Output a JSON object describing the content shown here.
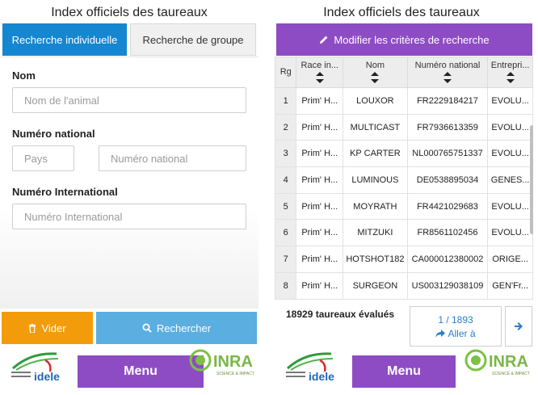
{
  "left": {
    "title": "Index officiels des taureaux",
    "tabs": {
      "individual": "Recherche individuelle",
      "group": "Recherche de groupe"
    },
    "form": {
      "name_label": "Nom",
      "name_placeholder": "Nom de l'animal",
      "national_label": "Numéro national",
      "country_placeholder": "Pays",
      "national_placeholder": "Numéro national",
      "international_label": "Numéro International",
      "international_placeholder": "Numéro International"
    },
    "buttons": {
      "clear": "Vider",
      "search": "Rechercher"
    },
    "menu": "Menu"
  },
  "right": {
    "title": "Index officiels des taureaux",
    "modify_button": "Modifier les critères de recherche",
    "table": {
      "headers": [
        "Rg",
        "Race in...",
        "Nom",
        "Numéro national",
        "Entrepri..."
      ],
      "rows": [
        [
          "1",
          "Prim' H...",
          "LOUXOR",
          "FR2229184217",
          "EVOLU..."
        ],
        [
          "2",
          "Prim' H...",
          "MULTICAST",
          "FR7936613359",
          "EVOLU..."
        ],
        [
          "3",
          "Prim' H...",
          "KP CARTER",
          "NL000765751337",
          "EVOLU..."
        ],
        [
          "4",
          "Prim' H...",
          "LUMINOUS",
          "DE0538895034",
          "GENES..."
        ],
        [
          "5",
          "Prim' H...",
          "MOYRATH",
          "FR4421029683",
          "EVOLU..."
        ],
        [
          "6",
          "Prim' H...",
          "MITZUKI",
          "FR8561102456",
          "EVOLU..."
        ],
        [
          "7",
          "Prim' H...",
          "HOTSHOT182",
          "CA000012380002",
          "ORIGE..."
        ],
        [
          "8",
          "Prim' H...",
          "SURGEON",
          "US003129038109",
          "GEN'Fr..."
        ]
      ]
    },
    "count_text": "18929 taureaux évalués",
    "pager": {
      "page": "1 / 1893",
      "goto": "Aller à"
    },
    "menu": "Menu"
  },
  "logos": {
    "idele": "idele",
    "inra": "INRA",
    "inra_tagline": "SCIENCE & IMPACT"
  },
  "colors": {
    "blue_tab": "#1586d0",
    "purple": "#8e4cc4",
    "orange": "#f39c0b",
    "light_blue": "#5aaee0",
    "link_blue": "#2a7fc8"
  }
}
